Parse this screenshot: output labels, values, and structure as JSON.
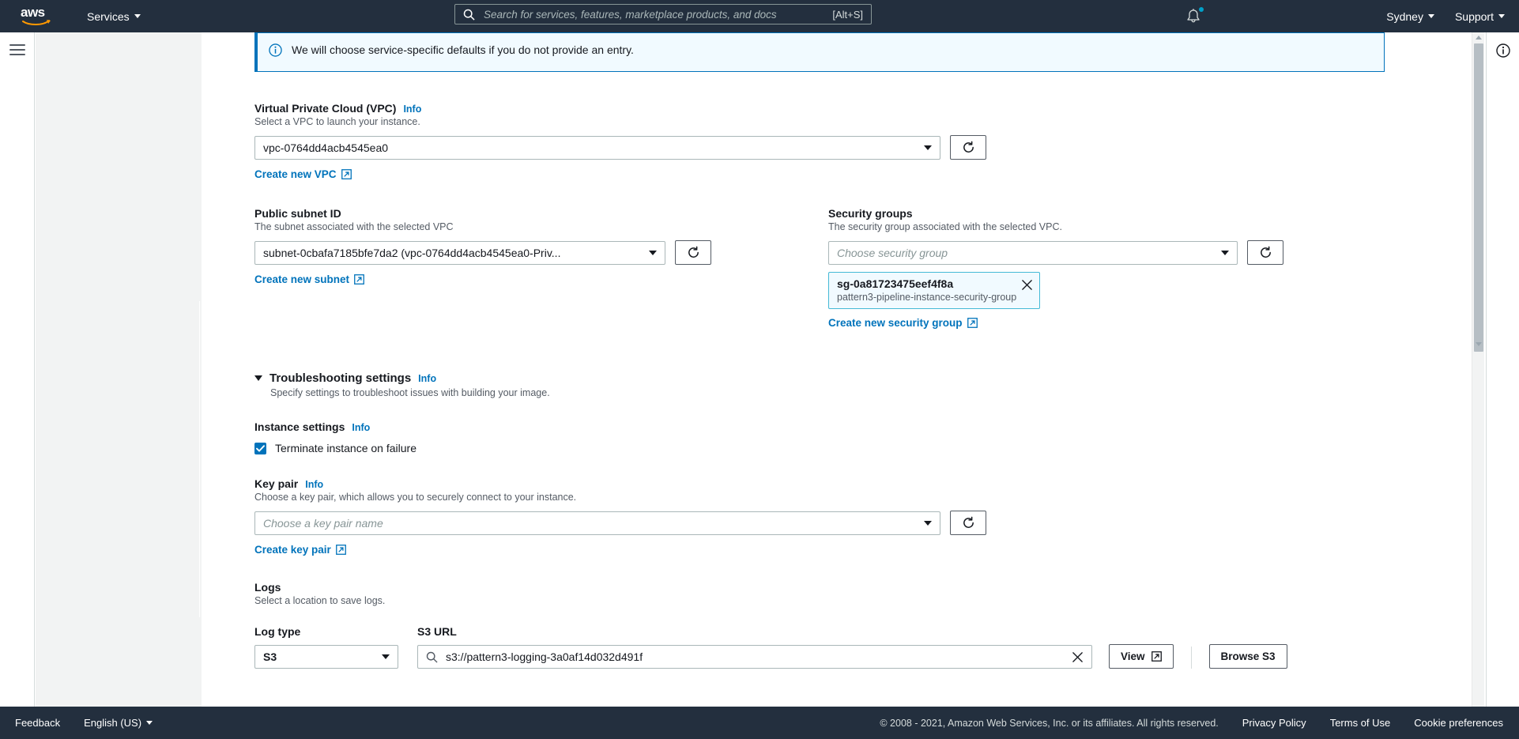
{
  "topnav": {
    "logo_text": "aws",
    "services_label": "Services",
    "search": {
      "placeholder": "Search for services, features, marketplace products, and docs",
      "value": "",
      "shortcut": "[Alt+S]"
    },
    "notifications_icon": "bell-icon",
    "region_label": "Sydney",
    "support_label": "Support"
  },
  "alert": {
    "icon": "info-circle-icon",
    "text": "We will choose service-specific defaults if you do not provide an entry."
  },
  "vpc": {
    "label": "Virtual Private Cloud (VPC)",
    "info": "Info",
    "description": "Select a VPC to launch your instance.",
    "value": "vpc-0764dd4acb4545ea0",
    "create_link": "Create new VPC"
  },
  "subnet": {
    "label": "Public subnet ID",
    "description": "The subnet associated with the selected VPC",
    "value": "subnet-0cbafa7185bfe7da2 (vpc-0764dd4acb4545ea0-Priv...",
    "create_link": "Create new subnet",
    "refresh_icon": "refresh-icon"
  },
  "security_groups": {
    "label": "Security groups",
    "description": "The security group associated with the selected VPC.",
    "placeholder": "Choose security group",
    "refresh_icon": "refresh-icon",
    "selected_token": {
      "id": "sg-0a81723475eef4f8a",
      "name": "pattern3-pipeline-instance-security-group",
      "remove_icon": "close-icon"
    },
    "create_link": "Create new security group"
  },
  "troubleshooting": {
    "title": "Troubleshooting settings",
    "info": "Info",
    "description": "Specify settings to troubleshoot issues with building your image.",
    "instance_settings": {
      "label": "Instance settings",
      "info": "Info",
      "checkbox_label": "Terminate instance on failure",
      "checked": true
    },
    "key_pair": {
      "label": "Key pair",
      "info": "Info",
      "description": "Choose a key pair, which allows you to securely connect to your instance.",
      "placeholder": "Choose a key pair name",
      "value": "",
      "create_link": "Create key pair",
      "refresh_icon": "refresh-icon"
    },
    "logs": {
      "label": "Logs",
      "description": "Select a location to save logs.",
      "log_type_label": "Log type",
      "log_type_value": "S3",
      "s3_url_label": "S3 URL",
      "s3_url_value": "s3://pattern3-logging-3a0af14d032d491f",
      "search_icon": "search-icon",
      "clear_icon": "close-icon",
      "view_button": "View",
      "browse_button": "Browse S3"
    }
  },
  "right_pane": {
    "info_icon": "info-circle-icon"
  },
  "footer": {
    "feedback": "Feedback",
    "language": "English (US)",
    "copyright": "© 2008 - 2021, Amazon Web Services, Inc. or its affiliates. All rights reserved.",
    "privacy": "Privacy Policy",
    "terms": "Terms of Use",
    "cookies": "Cookie preferences"
  }
}
